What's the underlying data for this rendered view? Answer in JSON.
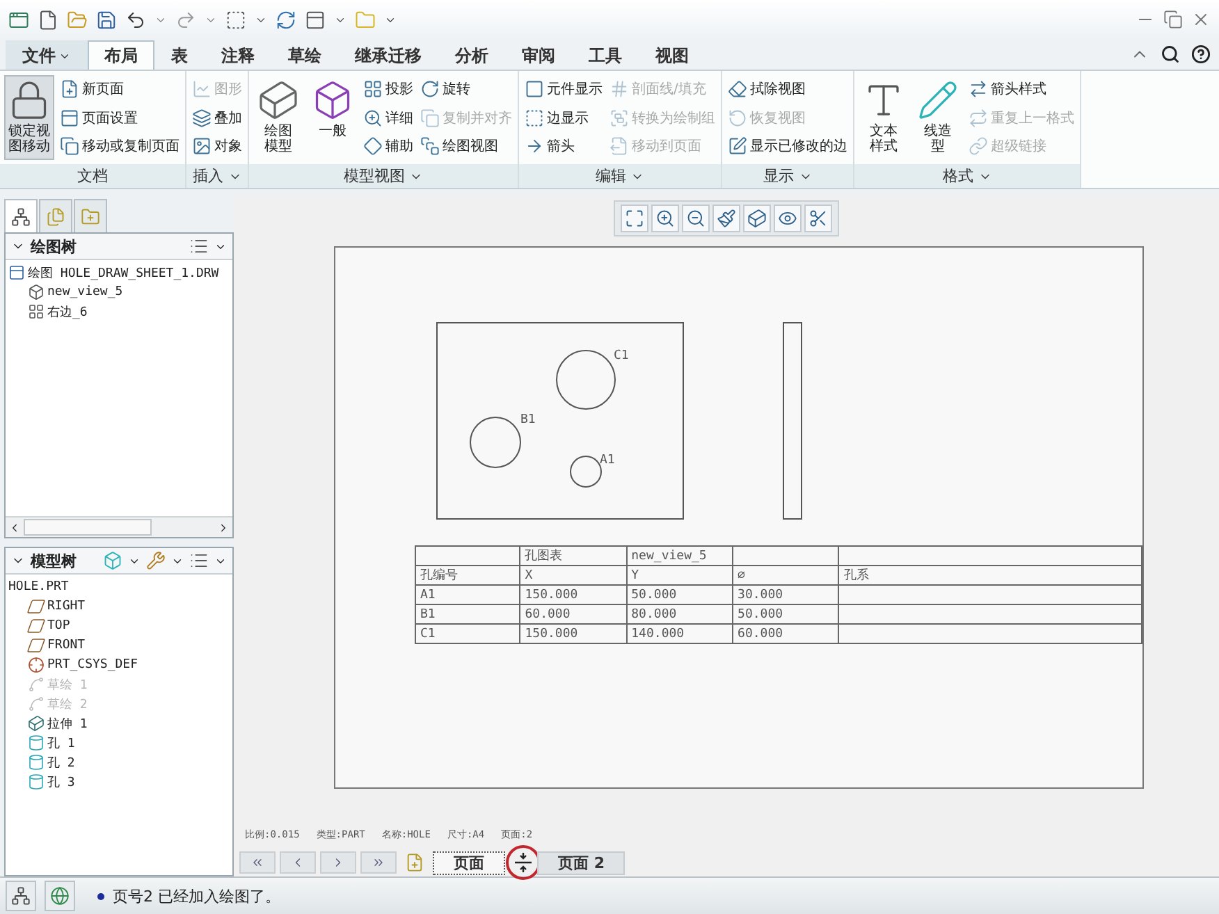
{
  "tabs": [
    {
      "label": "文件",
      "kind": "file",
      "selected": false
    },
    {
      "label": "布局",
      "kind": "tab",
      "selected": true
    },
    {
      "label": "表",
      "kind": "tab",
      "selected": false
    },
    {
      "label": "注释",
      "kind": "tab",
      "selected": false
    },
    {
      "label": "草绘",
      "kind": "tab",
      "selected": false
    },
    {
      "label": "继承迁移",
      "kind": "tab",
      "selected": false
    },
    {
      "label": "分析",
      "kind": "tab",
      "selected": false
    },
    {
      "label": "审阅",
      "kind": "tab",
      "selected": false
    },
    {
      "label": "工具",
      "kind": "tab",
      "selected": false
    },
    {
      "label": "视图",
      "kind": "tab",
      "selected": false
    }
  ],
  "ribbon": {
    "groups": [
      {
        "label": "文档",
        "menu": false,
        "items": [
          {
            "label": "锁定视图移动",
            "kind": "large",
            "on": true,
            "disabled": false
          },
          {
            "label": "新页面",
            "kind": "small",
            "disabled": false
          },
          {
            "label": "页面设置",
            "kind": "small",
            "disabled": false
          },
          {
            "label": "移动或复制页面",
            "kind": "small",
            "disabled": false
          }
        ]
      },
      {
        "label": "插入",
        "menu": true,
        "items": [
          {
            "label": "图形",
            "kind": "small",
            "disabled": true
          },
          {
            "label": "叠加",
            "kind": "small",
            "disabled": false
          },
          {
            "label": "对象",
            "kind": "small",
            "disabled": false
          }
        ]
      },
      {
        "label": "模型视图",
        "menu": true,
        "items": [
          {
            "label": "绘图模型",
            "kind": "large",
            "on": false,
            "disabled": false
          },
          {
            "label": "一般",
            "kind": "large",
            "on": false,
            "disabled": false
          },
          {
            "label": "投影",
            "kind": "small",
            "disabled": false
          },
          {
            "label": "详细",
            "kind": "small",
            "disabled": false
          },
          {
            "label": "辅助",
            "kind": "small",
            "disabled": false
          },
          {
            "label": "旋转",
            "kind": "small",
            "disabled": false
          },
          {
            "label": "复制并对齐",
            "kind": "small",
            "disabled": true
          },
          {
            "label": "绘图视图",
            "kind": "small",
            "disabled": false
          }
        ]
      },
      {
        "label": "编辑",
        "menu": true,
        "items": [
          {
            "label": "元件显示",
            "kind": "small",
            "disabled": false
          },
          {
            "label": "边显示",
            "kind": "small",
            "disabled": false
          },
          {
            "label": "箭头",
            "kind": "small",
            "disabled": false
          },
          {
            "label": "剖面线/填充",
            "kind": "small",
            "disabled": true
          },
          {
            "label": "转换为绘制组",
            "kind": "small",
            "disabled": true
          },
          {
            "label": "移动到页面",
            "kind": "small",
            "disabled": true
          }
        ]
      },
      {
        "label": "显示",
        "menu": true,
        "items": [
          {
            "label": "拭除视图",
            "kind": "small",
            "disabled": false
          },
          {
            "label": "恢复视图",
            "kind": "small",
            "disabled": true
          },
          {
            "label": "显示已修改的边",
            "kind": "small",
            "disabled": false
          }
        ]
      },
      {
        "label": "格式",
        "menu": true,
        "items": [
          {
            "label": "文本样式",
            "kind": "large",
            "on": false,
            "disabled": false
          },
          {
            "label": "线造型",
            "kind": "large",
            "on": false,
            "disabled": false
          },
          {
            "label": "箭头样式",
            "kind": "small",
            "disabled": false
          },
          {
            "label": "重复上一格式",
            "kind": "small",
            "disabled": true
          },
          {
            "label": "超级链接",
            "kind": "small",
            "disabled": true
          }
        ]
      }
    ]
  },
  "navigator_tabs": [
    {
      "selected": true
    },
    {
      "selected": false
    },
    {
      "selected": false
    }
  ],
  "drawing_tree": {
    "title": "绘图树",
    "items": [
      {
        "label": "绘图 HOLE_DRAW_SHEET_1.DRW",
        "kind": "drawing",
        "disabled": false,
        "children": [
          {
            "label": "new_view_5",
            "kind": "view",
            "disabled": false
          },
          {
            "label": "右边_6",
            "kind": "projection",
            "disabled": false
          }
        ]
      }
    ]
  },
  "model_tree": {
    "title": "模型树",
    "items": [
      {
        "label": "HOLE.PRT",
        "disabled": false,
        "children": [
          {
            "label": "RIGHT",
            "kind": "plane",
            "disabled": false
          },
          {
            "label": "TOP",
            "kind": "plane",
            "disabled": false
          },
          {
            "label": "FRONT",
            "kind": "plane",
            "disabled": false
          },
          {
            "label": "PRT_CSYS_DEF",
            "kind": "csys",
            "disabled": false
          },
          {
            "label": "草绘 1",
            "kind": "sketch",
            "disabled": true
          },
          {
            "label": "草绘 2",
            "kind": "sketch",
            "disabled": true
          },
          {
            "label": "拉伸 1",
            "kind": "extrude",
            "disabled": false
          },
          {
            "label": "孔 1",
            "kind": "hole",
            "disabled": false
          },
          {
            "label": "孔 2",
            "kind": "hole",
            "disabled": false
          },
          {
            "label": "孔 3",
            "kind": "hole",
            "disabled": false
          }
        ]
      }
    ]
  },
  "drawing": {
    "holes": [
      {
        "label": "C1"
      },
      {
        "label": "B1"
      },
      {
        "label": "A1"
      }
    ],
    "hole_table": {
      "title_cells": [
        "孔图表",
        "new_view_5"
      ],
      "columns": [
        "孔编号",
        "X",
        "Y",
        "⌀",
        "孔系"
      ],
      "rows": [
        [
          "A1",
          "150.000",
          "50.000",
          "30.000"
        ],
        [
          "B1",
          "60.000",
          "80.000",
          "50.000"
        ],
        [
          "C1",
          "150.000",
          "140.000",
          "60.000"
        ]
      ]
    }
  },
  "sheet_info": [
    "比例:0.015",
    "类型:PART",
    "名称:HOLE",
    "尺寸:A4",
    "页面:2"
  ],
  "pages": [
    {
      "label": "页面",
      "selected": true
    },
    {
      "label": "页面 2",
      "selected": false
    }
  ],
  "status_bar": {
    "message": "页号2 已经加入绘图了。"
  }
}
